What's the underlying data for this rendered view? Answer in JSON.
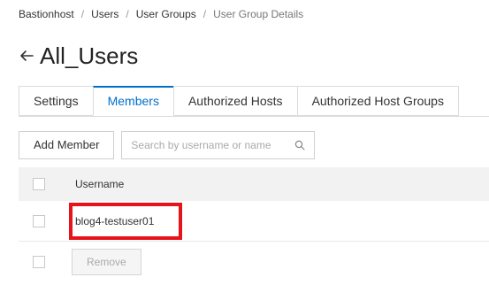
{
  "breadcrumb": {
    "items": [
      "Bastionhost",
      "Users",
      "User Groups",
      "User Group Details"
    ],
    "separator": "/"
  },
  "page": {
    "title": "All_Users",
    "back_icon": "arrow-left-icon"
  },
  "tabs": [
    {
      "label": "Settings",
      "active": false
    },
    {
      "label": "Members",
      "active": true
    },
    {
      "label": "Authorized Hosts",
      "active": false
    },
    {
      "label": "Authorized Host Groups",
      "active": false
    }
  ],
  "toolbar": {
    "add_member_label": "Add Member",
    "search_placeholder": "Search by username or name",
    "search_value": "",
    "search_icon": "search-icon"
  },
  "table": {
    "columns": [
      "Username"
    ],
    "rows": [
      {
        "username": "blog4-testuser01",
        "highlighted": true
      }
    ]
  },
  "footer": {
    "remove_label": "Remove"
  },
  "colors": {
    "accent": "#0070cc",
    "highlight": "#e8121a",
    "header_bg": "#f2f2f2"
  }
}
